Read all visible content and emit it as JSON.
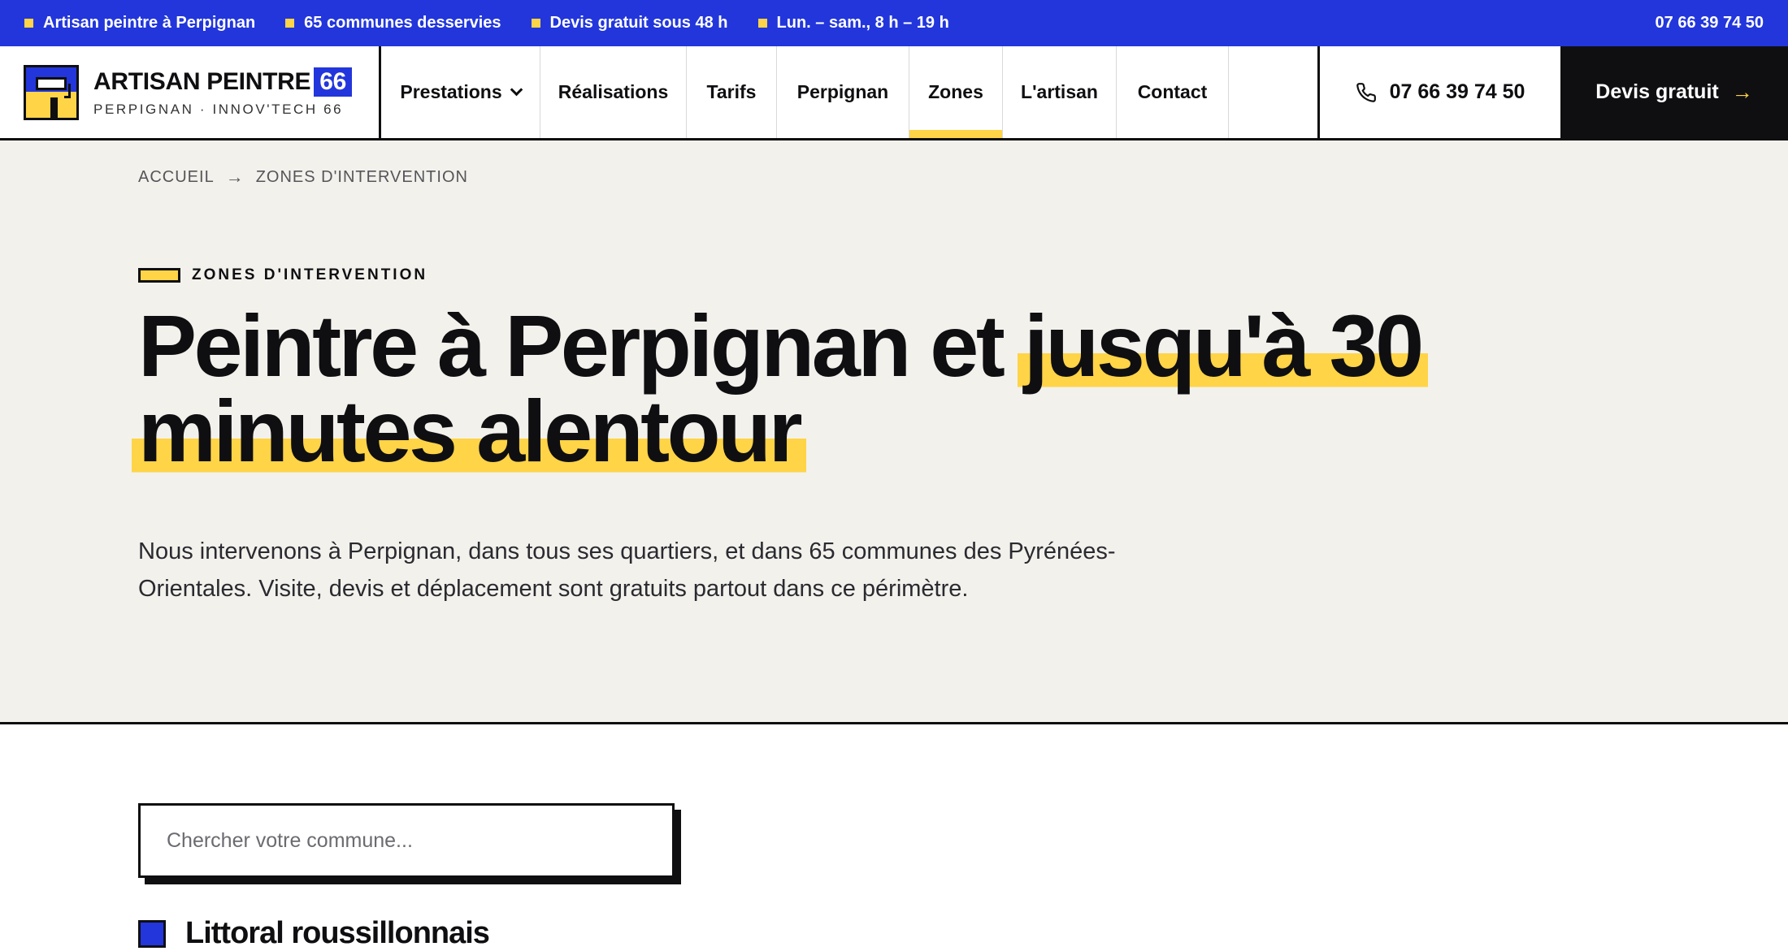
{
  "topbar": {
    "items": [
      "Artisan peintre à Perpignan",
      "65 communes desservies",
      "Devis gratuit sous 48 h",
      "Lun. – sam., 8 h – 19 h"
    ],
    "phone": "07 66 39 74 50",
    "bg_color": "#2236dc",
    "dot_color": "#ffd447"
  },
  "brand": {
    "name": "ARTISAN PEINTRE",
    "badge": "66",
    "tagline": "PERPIGNAN · INNOV'TECH 66",
    "logo_icon": "paint-roller-icon"
  },
  "nav": {
    "items": [
      {
        "label": "Prestations",
        "has_dropdown": true,
        "active": false
      },
      {
        "label": "Réalisations",
        "has_dropdown": false,
        "active": false
      },
      {
        "label": "Tarifs",
        "has_dropdown": false,
        "active": false
      },
      {
        "label": "Perpignan",
        "has_dropdown": false,
        "active": false
      },
      {
        "label": "Zones",
        "has_dropdown": false,
        "active": true
      },
      {
        "label": "L'artisan",
        "has_dropdown": false,
        "active": false
      },
      {
        "label": "Contact",
        "has_dropdown": false,
        "active": false
      }
    ],
    "active_color": "#ffd447"
  },
  "header": {
    "phone": "07 66 39 74 50",
    "phone_icon": "phone-icon",
    "cta_label": "Devis gratuit",
    "cta_arrow": "→"
  },
  "breadcrumb": {
    "home": "ACCUEIL",
    "separator": "→",
    "current": "ZONES D'INTERVENTION"
  },
  "hero": {
    "eyebrow": "ZONES D'INTERVENTION",
    "title_part1": "Peintre à Perpignan et ",
    "title_highlight1": "jusqu'à 30",
    "title_highlight2": "minutes alentour",
    "lead": "Nous intervenons à Perpignan, dans tous ses quartiers, et dans 65 communes des Pyrénées-Orientales. Visite, devis et déplacement sont gratuits partout dans ce périmètre.",
    "highlight_color": "#ffd447",
    "bg_color": "#f2f1ec"
  },
  "search": {
    "placeholder": "Chercher votre commune..."
  },
  "section": {
    "title": "Littoral roussillonnais",
    "marker_color": "#2236dc"
  }
}
